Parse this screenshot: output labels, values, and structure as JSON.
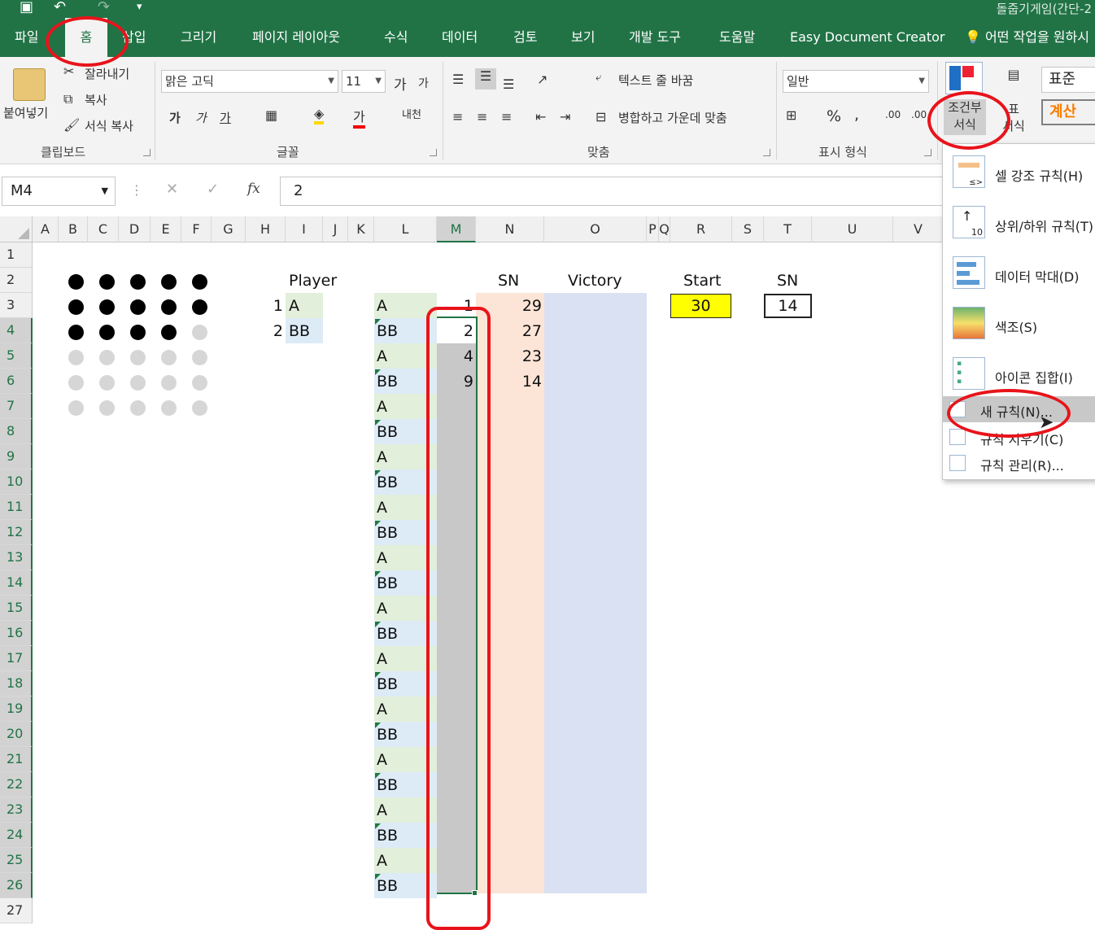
{
  "title_bar": {
    "document_name": "돌줍기게임(간단-2"
  },
  "tabs": [
    "파일",
    "홈",
    "삽입",
    "그리기",
    "페이지 레이아웃",
    "수식",
    "데이터",
    "검토",
    "보기",
    "개발 도구",
    "도움말",
    "Easy Document Creator"
  ],
  "tell_me": "어떤 작업을 원하시",
  "clipboard": {
    "paste": "붙여넣기",
    "cut": "잘라내기",
    "copy": "복사",
    "format_painter": "서식 복사",
    "group": "클립보드"
  },
  "font": {
    "name": "맑은 고딕",
    "size": "11",
    "bold": "가",
    "italic": "가",
    "underline": "가",
    "group": "글꼴",
    "grow": "가",
    "shrink": "가",
    "phonetic": "내천"
  },
  "alignment": {
    "wrap_text": "텍스트 줄 바꿈",
    "merge_center": "병합하고 가운데 맞춤",
    "group": "맞춤"
  },
  "number": {
    "format": "일반",
    "percent": "%",
    "comma": ",",
    "inc_decimal": ".00",
    "dec_decimal": ".00",
    "group": "표시 형식"
  },
  "styles": {
    "conditional_formatting": [
      "조건부",
      "서식"
    ],
    "format_table": [
      "표",
      "서식"
    ],
    "style_normal": "표준",
    "style_calc": "계산"
  },
  "formula_bar": {
    "name_box": "M4",
    "value": "2",
    "fx": "fx"
  },
  "columns": [
    "A",
    "B",
    "C",
    "D",
    "E",
    "F",
    "G",
    "H",
    "I",
    "J",
    "K",
    "L",
    "M",
    "N",
    "O",
    "P",
    "Q",
    "R",
    "S",
    "T",
    "U",
    "V"
  ],
  "rows": [
    "1",
    "2",
    "3",
    "4",
    "5",
    "6",
    "7",
    "8",
    "9",
    "10",
    "11",
    "12",
    "13",
    "14",
    "15",
    "16",
    "17",
    "18",
    "19",
    "20",
    "21",
    "22",
    "23",
    "24",
    "25",
    "26",
    "27"
  ],
  "stones": [
    [
      1,
      1,
      1,
      1,
      1
    ],
    [
      1,
      1,
      1,
      1,
      1
    ],
    [
      1,
      1,
      1,
      1,
      0
    ],
    [
      0,
      0,
      0,
      0,
      0
    ],
    [
      0,
      0,
      0,
      0,
      0
    ],
    [
      0,
      0,
      0,
      0,
      0
    ]
  ],
  "headers": {
    "player": "Player",
    "sn": "SN",
    "victory": "Victory",
    "start": "Start",
    "sn2": "SN"
  },
  "players": [
    {
      "num": "1",
      "name": "A"
    },
    {
      "num": "2",
      "name": "BB"
    }
  ],
  "col_L": [
    "A",
    "BB",
    "A",
    "BB",
    "A",
    "BB",
    "A",
    "BB",
    "A",
    "BB",
    "A",
    "BB",
    "A",
    "BB",
    "A",
    "BB",
    "A",
    "BB",
    "A",
    "BB",
    "A",
    "BB",
    "A",
    "BB"
  ],
  "col_M": [
    "1",
    "2",
    "4",
    "9"
  ],
  "col_N": [
    "29",
    "27",
    "23",
    "14"
  ],
  "start_value": "30",
  "sn_value": "14",
  "colors": {
    "excel_green": "#217346",
    "green_fill": "#e2efda",
    "blue_fill": "#ddebf7",
    "salmon_fill": "#fce4d6",
    "lavender_fill": "#d9e1f2",
    "yellow": "#ffff00",
    "selection_gray": "#c8c8c8",
    "annotation_red": "#e8141b"
  },
  "menu": {
    "items": [
      "셀 강조 규칙(H)",
      "상위/하위 규칙(T)",
      "데이터 막대(D)",
      "색조(S)",
      "아이콘 집합(I)"
    ],
    "small_items": [
      "새 규칙(N)...",
      "규칙 지우기(C)",
      "규칙 관리(R)..."
    ]
  }
}
